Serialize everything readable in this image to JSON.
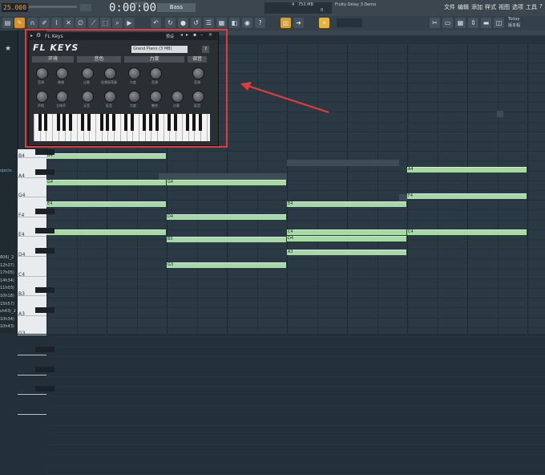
{
  "topbar": {
    "tempo": "25.000",
    "time": "0:00:00",
    "time_unit": "M:S:CS",
    "pattern": "Bass",
    "cpu": "4",
    "memory": "753 MB",
    "cpu_sub": "0",
    "hint": "Fruity Delay 3 Demo",
    "menu": [
      "文件",
      "编辑",
      "添加",
      "样式",
      "视图",
      "选项",
      "工具",
      "?"
    ],
    "today": "Today",
    "version": "版本程"
  },
  "plugin": {
    "title": "FL Keys",
    "logo": "FL KEYS",
    "preset_label": "预设",
    "preset": "Grand Piano (3 MB)",
    "sections": [
      "环境",
      "音色",
      "力度",
      "调音"
    ],
    "row1_labels": [
      "音调",
      "降噪",
      "过载",
      "低频振荡器",
      "力度",
      "音调"
    ],
    "row2_labels": [
      "声相",
      "立体声",
      "泛音",
      "延音",
      "力度",
      "触控",
      "过载",
      "延音"
    ],
    "right_labels": [
      "音调",
      "音调"
    ]
  },
  "ruler": [
    "5",
    "7",
    "8",
    "9"
  ],
  "left_panel": {
    "projects": "rojects",
    "items": [
      "806)_2",
      "12h37)",
      "17h05)",
      "14h34)",
      "11h03)",
      "10h18)",
      "15h57)",
      "sh43)_2",
      "10h34)",
      "10h43)"
    ]
  },
  "keys": [
    "B4",
    "A4",
    "G4",
    "F4",
    "E4",
    "D4",
    "C4",
    "B3",
    "A3",
    "G3",
    "F3",
    "E3",
    "D3",
    "C3"
  ],
  "notes": [
    {
      "label": "B4"
    },
    {
      "label": "G4"
    },
    {
      "label": "G4"
    },
    {
      "label": "E4"
    },
    {
      "label": "D4"
    },
    {
      "label": "C4"
    },
    {
      "label": "B3"
    },
    {
      "label": "G3"
    },
    {
      "label": "E4"
    },
    {
      "label": "A4"
    },
    {
      "label": "F4"
    },
    {
      "label": "C4"
    },
    {
      "label": "C4"
    },
    {
      "label": "D4"
    },
    {
      "label": "A3"
    }
  ],
  "colors": {
    "note": "#a6d8a8",
    "highlight": "#e23b3b",
    "grid": "#2b3944"
  }
}
